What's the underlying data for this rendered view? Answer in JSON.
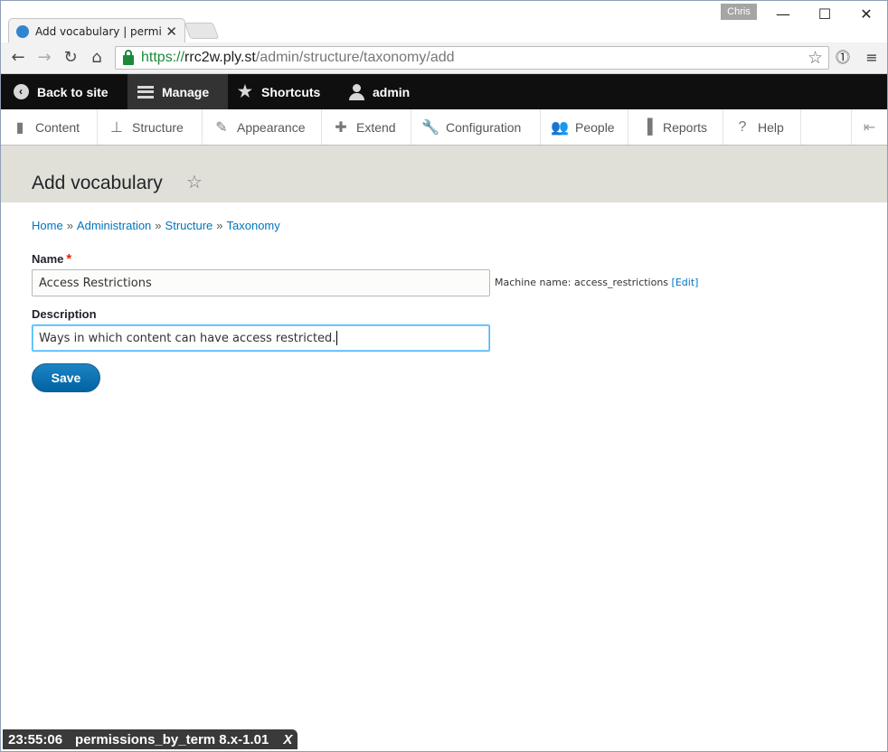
{
  "browser": {
    "tab_title": "Add vocabulary | permissi",
    "tab_close": "✕",
    "profile_name": "Chris",
    "url_scheme": "https://",
    "url_host": "rrc2w.ply.st",
    "url_path": "/admin/structure/taxonomy/add",
    "window_min": "—",
    "window_max": "☐",
    "window_close": "✕"
  },
  "toolbar": {
    "back_to_site": "Back to site",
    "manage": "Manage",
    "shortcuts": "Shortcuts",
    "user": "admin"
  },
  "admin_menu": {
    "items": [
      {
        "label": "Content",
        "icon": "page-icon"
      },
      {
        "label": "Structure",
        "icon": "sitemap-icon"
      },
      {
        "label": "Appearance",
        "icon": "brush-icon"
      },
      {
        "label": "Extend",
        "icon": "puzzle-icon"
      },
      {
        "label": "Configuration",
        "icon": "wrench-icon"
      },
      {
        "label": "People",
        "icon": "people-icon"
      },
      {
        "label": "Reports",
        "icon": "bar-chart-icon"
      },
      {
        "label": "Help",
        "icon": "help-icon"
      }
    ]
  },
  "page": {
    "title": "Add vocabulary"
  },
  "breadcrumb": {
    "items": [
      "Home",
      "Administration",
      "Structure",
      "Taxonomy"
    ],
    "separator": "»"
  },
  "form": {
    "name_label": "Name",
    "required_marker": "*",
    "name_value": "Access Restrictions",
    "machine_name_label": "Machine name:",
    "machine_name_value": "access_restrictions",
    "machine_name_edit": "[Edit]",
    "description_label": "Description",
    "description_value": "Ways in which content can have access restricted.",
    "save_label": "Save"
  },
  "status_overlay": {
    "time": "23:55:06",
    "text": "permissions_by_term 8.x-1.01",
    "close": "X"
  },
  "colors": {
    "toolbar_bg": "#0f0f0f",
    "page_header_bg": "#e0e0d8",
    "link": "#0074bd",
    "primary_button": "#0071b8",
    "required": "#e62600"
  }
}
